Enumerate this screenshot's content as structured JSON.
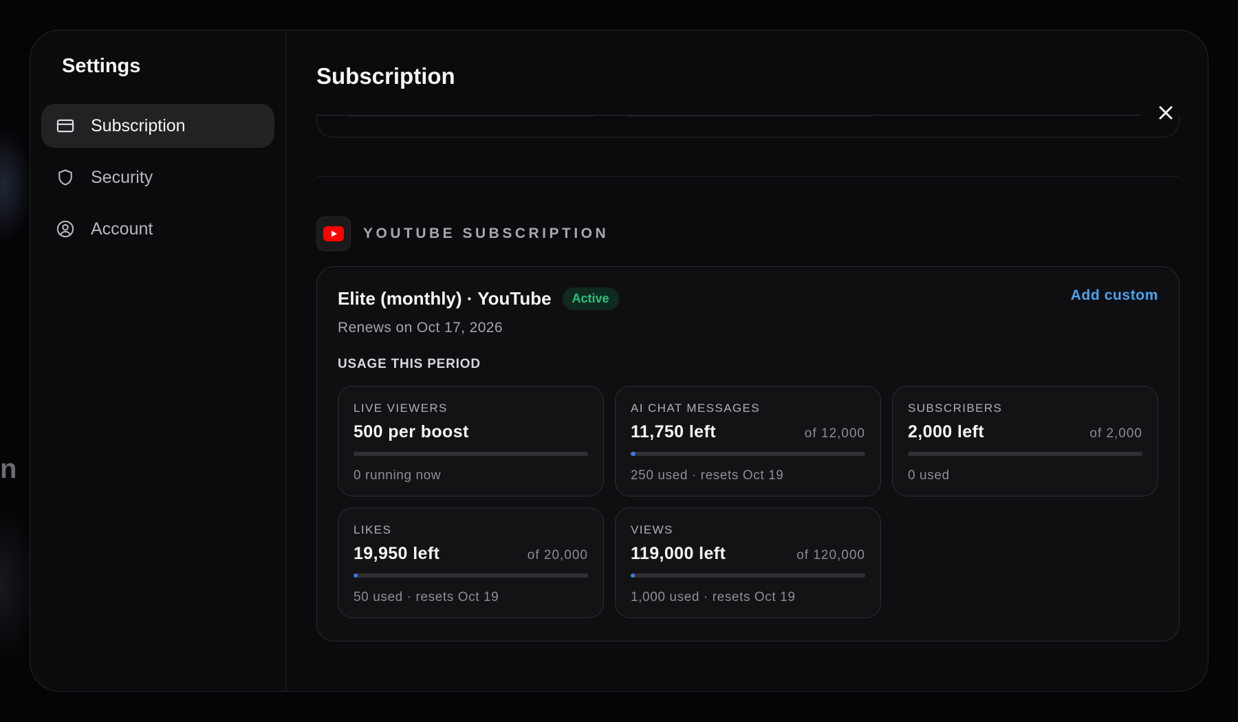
{
  "sidebar": {
    "title": "Settings",
    "items": [
      {
        "label": "Subscription",
        "icon": "credit-card-icon",
        "active": true
      },
      {
        "label": "Security",
        "icon": "shield-icon",
        "active": false
      },
      {
        "label": "Account",
        "icon": "user-circle-icon",
        "active": false
      }
    ]
  },
  "main": {
    "title": "Subscription",
    "close_icon": "close-icon"
  },
  "youtube_section": {
    "label": "YOUTUBE SUBSCRIPTION",
    "icon": "youtube-icon",
    "plan": {
      "name": "Elite (monthly) · YouTube",
      "status": "Active",
      "renews": "Renews on Oct 17, 2026",
      "add_custom": "Add custom"
    },
    "usage_title": "USAGE THIS PERIOD",
    "usage": [
      {
        "label": "LIVE VIEWERS",
        "value": "500 per boost",
        "of": "",
        "progress": 0,
        "foot": "0 running now"
      },
      {
        "label": "AI CHAT MESSAGES",
        "value": "11,750 left",
        "of": "of 12,000",
        "progress": 0.021,
        "foot": "250 used · resets Oct 19"
      },
      {
        "label": "SUBSCRIBERS",
        "value": "2,000 left",
        "of": "of 2,000",
        "progress": 0,
        "foot": "0 used"
      },
      {
        "label": "LIKES",
        "value": "19,950 left",
        "of": "of 20,000",
        "progress": 0.0025,
        "foot": "50 used · resets Oct 19"
      },
      {
        "label": "VIEWS",
        "value": "119,000 left",
        "of": "of 120,000",
        "progress": 0.0083,
        "foot": "1,000 used · resets Oct 19"
      }
    ]
  },
  "colors": {
    "accent_link": "#4aa3f0",
    "active_badge_text": "#27c27a",
    "active_badge_bg": "#0f2a1f",
    "progress_fill": "#3d7be6",
    "youtube_red": "#ff0000"
  }
}
